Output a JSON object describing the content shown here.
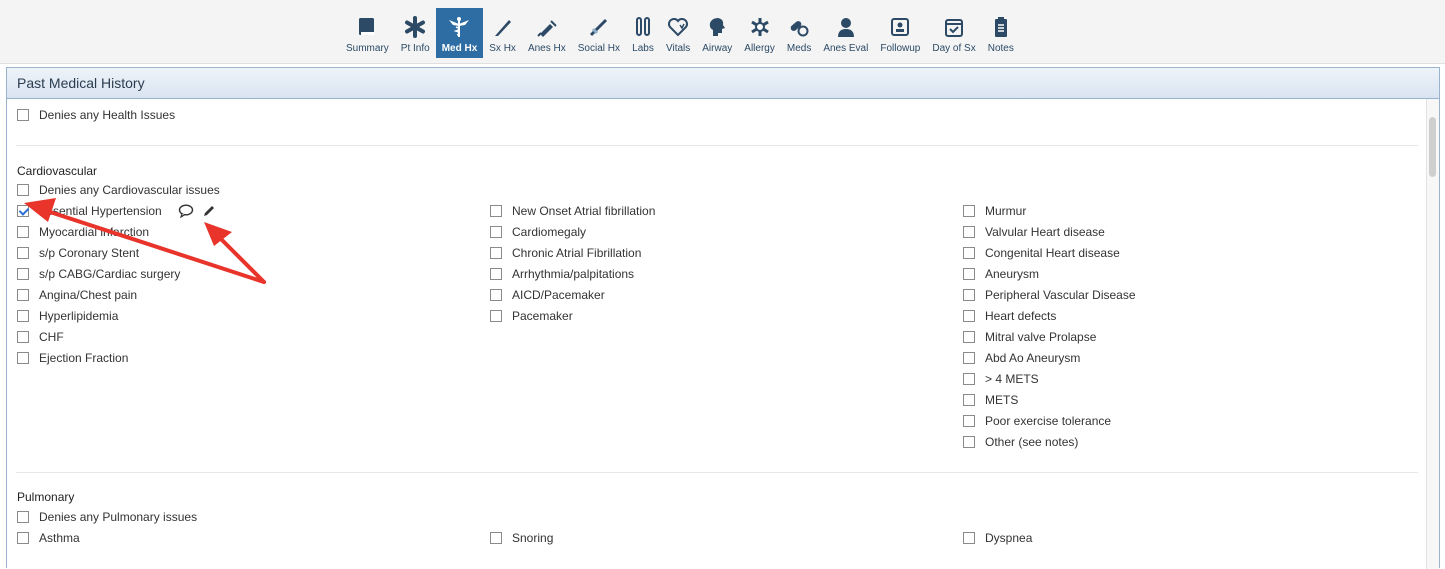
{
  "toolbar": {
    "tabs": [
      {
        "label": "Summary",
        "icon": "book-icon"
      },
      {
        "label": "Pt Info",
        "icon": "asterisk-icon"
      },
      {
        "label": "Med Hx",
        "icon": "caduceus-icon",
        "active": true
      },
      {
        "label": "Sx Hx",
        "icon": "scalpel-icon"
      },
      {
        "label": "Anes Hx",
        "icon": "syringe-icon"
      },
      {
        "label": "Social Hx",
        "icon": "needle-icon"
      },
      {
        "label": "Labs",
        "icon": "test-tubes-icon"
      },
      {
        "label": "Vitals",
        "icon": "heart-pulse-icon"
      },
      {
        "label": "Airway",
        "icon": "head-profile-icon"
      },
      {
        "label": "Allergy",
        "icon": "allergy-icon"
      },
      {
        "label": "Meds",
        "icon": "pills-icon"
      },
      {
        "label": "Anes Eval",
        "icon": "doctor-icon"
      },
      {
        "label": "Followup",
        "icon": "followup-icon"
      },
      {
        "label": "Day of Sx",
        "icon": "calendar-check-icon"
      },
      {
        "label": "Notes",
        "icon": "clipboard-icon"
      }
    ]
  },
  "panel": {
    "title": "Past Medical History"
  },
  "general": {
    "denies": "Denies any Health Issues"
  },
  "cardio": {
    "title": "Cardiovascular",
    "denies": "Denies any Cardiovascular issues",
    "col1": [
      "Essential Hypertension",
      "Myocardial infarction",
      "s/p Coronary Stent",
      "s/p CABG/Cardiac surgery",
      "Angina/Chest pain",
      "Hyperlipidemia",
      "CHF",
      "Ejection Fraction"
    ],
    "col2": [
      "New Onset Atrial fibrillation",
      "Cardiomegaly",
      "Chronic Atrial Fibrillation",
      "Arrhythmia/palpitations",
      "AICD/Pacemaker",
      "Pacemaker"
    ],
    "col3": [
      "Murmur",
      "Valvular Heart disease",
      "Congenital Heart disease",
      "Aneurysm",
      "Peripheral Vascular Disease",
      "Heart defects",
      "Mitral valve Prolapse",
      "Abd Ao Aneurysm",
      "> 4 METS",
      "METS",
      "Poor exercise tolerance",
      "Other (see notes)"
    ],
    "checked": [
      "Essential Hypertension"
    ]
  },
  "pulmonary": {
    "title": "Pulmonary",
    "denies": "Denies any Pulmonary issues",
    "col1": [
      "Asthma"
    ],
    "col2": [
      "Snoring"
    ],
    "col3": [
      "Dyspnea"
    ]
  },
  "colors": {
    "accent": "#2e6da4",
    "arrow": "#e8342a",
    "check": "#2a6fd3"
  }
}
